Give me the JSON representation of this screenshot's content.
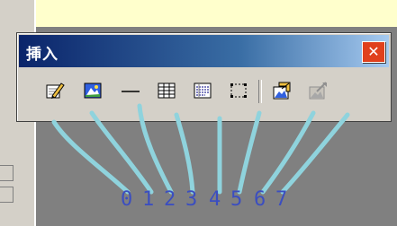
{
  "window": {
    "title": "挿入",
    "close_glyph": "✕"
  },
  "toolbar": {
    "buttons": [
      {
        "index": "0",
        "icon": "edit-pencil-icon"
      },
      {
        "index": "1",
        "icon": "picture-landscape-icon"
      },
      {
        "index": "2",
        "icon": "horizontal-line-icon"
      },
      {
        "index": "3",
        "icon": "table-grid-icon"
      },
      {
        "index": "4",
        "icon": "form-list-icon"
      },
      {
        "index": "5",
        "icon": "dotted-frame-icon"
      },
      {
        "index": "6",
        "icon": "image-chart-icon"
      },
      {
        "index": "7",
        "icon": "disabled-image-icon"
      }
    ]
  },
  "colors": {
    "annotation_line": "#8fd3dd",
    "annotation_text": "#3b4ec0",
    "title_gradient_start": "#0a246a",
    "close_button": "#e0401c"
  }
}
